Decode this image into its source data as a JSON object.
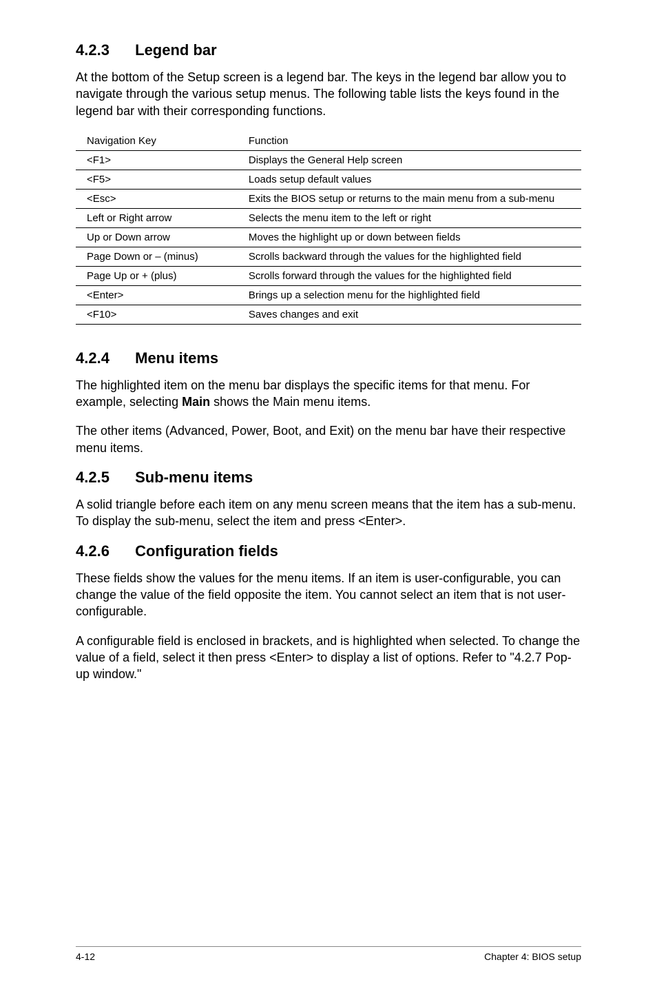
{
  "sections": {
    "s423": {
      "num": "4.2.3",
      "title": "Legend bar",
      "intro": "At the bottom of the Setup screen is a legend bar. The keys in the legend bar allow you to navigate through the various setup menus. The following table lists the keys found in the legend bar with their corresponding functions."
    },
    "s424": {
      "num": "4.2.4",
      "title": "Menu items",
      "p1a": "The highlighted item on the menu bar  displays the specific items for that menu. For example, selecting ",
      "p1b": "Main",
      "p1c": " shows the Main menu items.",
      "p2": "The other items (Advanced, Power, Boot, and Exit) on the menu bar have their respective menu items."
    },
    "s425": {
      "num": "4.2.5",
      "title": "Sub-menu items",
      "p1": "A solid triangle before each item on any menu screen means that the item has a sub-menu. To display the sub-menu, select the item and press <Enter>."
    },
    "s426": {
      "num": "4.2.6",
      "title": "Configuration fields",
      "p1": "These fields show the values for the menu items. If an item is user-configurable, you can change the value of the field opposite the item. You cannot select an item that is not user-configurable.",
      "p2": "A configurable field is enclosed in brackets, and is highlighted when selected. To change the value of a field, select it then press <Enter> to display a list of options. Refer to \"4.2.7 Pop-up window.\""
    }
  },
  "table": {
    "headers": {
      "key": "Navigation Key",
      "func": "Function"
    },
    "rows": [
      {
        "key": "<F1>",
        "func": "Displays the General Help screen"
      },
      {
        "key": "<F5>",
        "func": "Loads setup default values"
      },
      {
        "key": "<Esc>",
        "func": "Exits the BIOS setup or returns to the main menu from a sub-menu"
      },
      {
        "key": "Left or Right arrow",
        "func": "Selects the menu item to the left or right"
      },
      {
        "key": "Up or Down arrow",
        "func": "Moves the highlight up or down between fields"
      },
      {
        "key": "Page Down or – (minus)",
        "func": "Scrolls backward through the values for the highlighted field"
      },
      {
        "key": "Page Up or + (plus)",
        "func": "Scrolls forward through the values for the highlighted field"
      },
      {
        "key": "<Enter>",
        "func": "Brings up a selection menu for the highlighted field"
      },
      {
        "key": "<F10>",
        "func": "Saves changes and exit"
      }
    ]
  },
  "footer": {
    "left": "4-12",
    "right": "Chapter 4: BIOS setup"
  }
}
